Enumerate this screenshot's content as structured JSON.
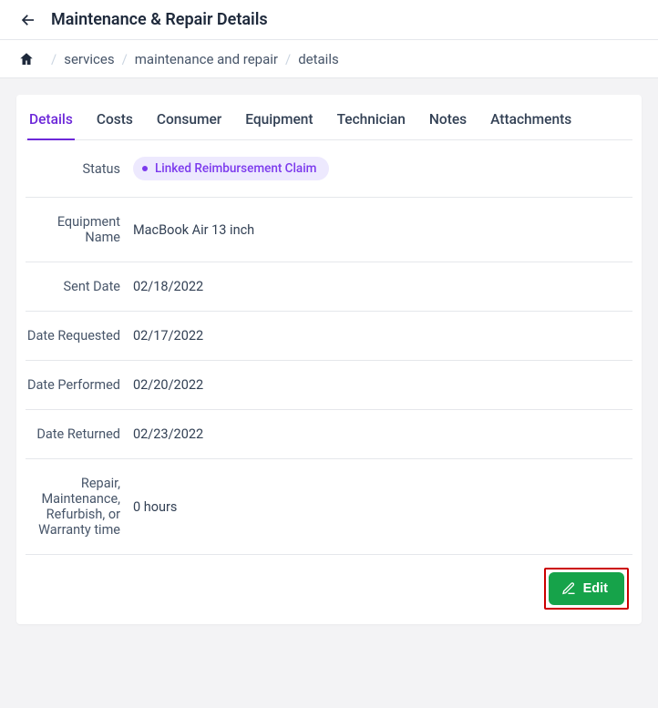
{
  "header": {
    "title": "Maintenance & Repair Details"
  },
  "breadcrumb": {
    "items": [
      "services",
      "maintenance and repair",
      "details"
    ]
  },
  "tabs": {
    "items": [
      "Details",
      "Costs",
      "Consumer",
      "Equipment",
      "Technician",
      "Notes",
      "Attachments"
    ],
    "active": "Details"
  },
  "details": {
    "status_label": "Status",
    "status_value": "Linked Reimbursement Claim",
    "equipment_name_label": "Equipment Name",
    "equipment_name_value": "MacBook Air 13 inch",
    "sent_date_label": "Sent Date",
    "sent_date_value": "02/18/2022",
    "date_requested_label": "Date Requested",
    "date_requested_value": "02/17/2022",
    "date_performed_label": "Date Performed",
    "date_performed_value": "02/20/2022",
    "date_returned_label": "Date Returned",
    "date_returned_value": "02/23/2022",
    "time_label": "Repair, Maintenance, Refurbish, or Warranty time",
    "time_value": "0 hours"
  },
  "actions": {
    "edit_label": "Edit"
  }
}
